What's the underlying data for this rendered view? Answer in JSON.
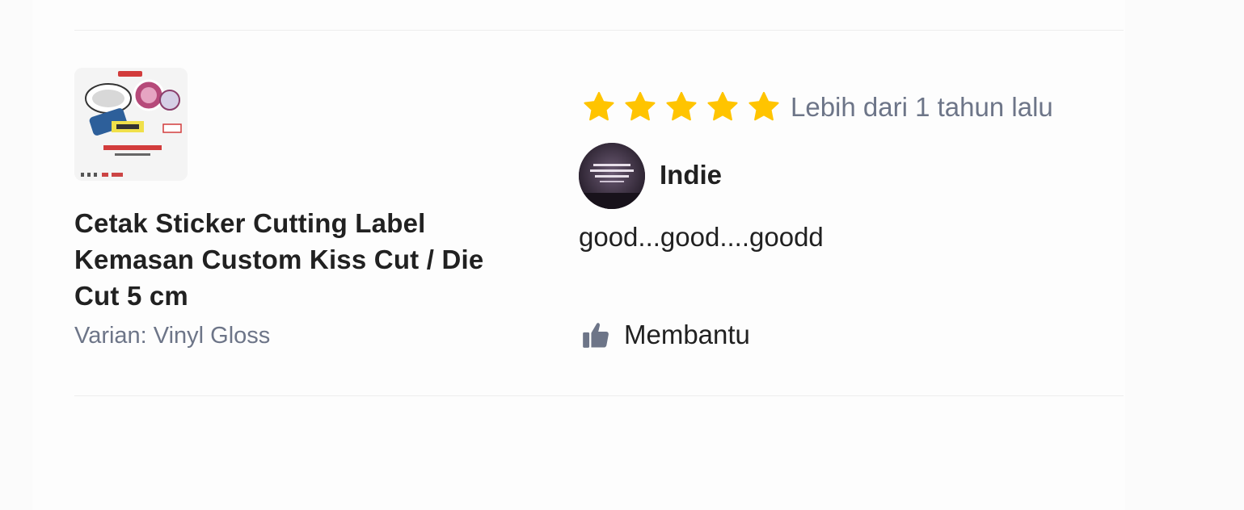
{
  "product": {
    "name": "Cetak Sticker Cutting Label Kemasan Custom Kiss Cut / Die Cut 5 cm",
    "variant": "Varian: Vinyl Gloss",
    "image_icon": "product-thumbnail"
  },
  "review": {
    "rating": 5,
    "rating_max": 5,
    "timestamp": "Lebih dari 1 tahun lalu",
    "reviewer_name": "Indie",
    "text": "good...good....goodd",
    "helpful_label": "Membantu",
    "helpful_icon": "thumbs-up-icon",
    "avatar_icon": "avatar-image"
  },
  "colors": {
    "star": "#FFC400",
    "muted_text": "#6D7588",
    "primary_text": "#212121",
    "thumbs_icon": "#6D7588"
  }
}
